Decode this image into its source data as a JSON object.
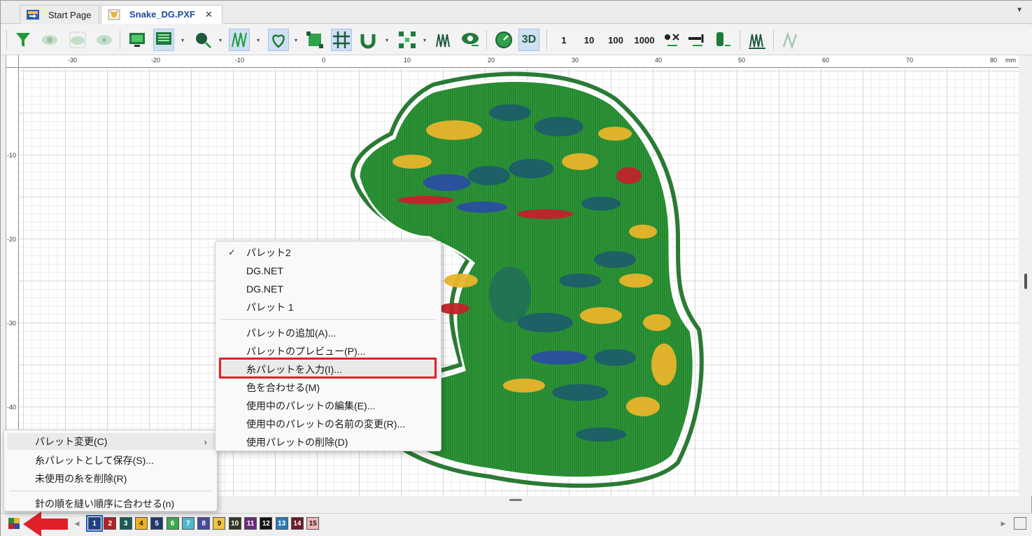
{
  "tabs": {
    "start_page": "Start Page",
    "active_file": "Snake_DG.PXF",
    "close": "✕"
  },
  "toolbar": {
    "count_buttons": [
      "1",
      "10",
      "100",
      "1000"
    ],
    "view_3d": "3D"
  },
  "ruler": {
    "unit": "mm",
    "h_labels": [
      "-30",
      "-20",
      "-10",
      "0",
      "10",
      "20",
      "30",
      "40",
      "50",
      "60",
      "70",
      "80"
    ],
    "v_labels": [
      "-10",
      "-20",
      "-30",
      "-40"
    ]
  },
  "menu_main": {
    "items": [
      {
        "label": "パレット変更(C)",
        "has_submenu": true
      },
      {
        "label": "糸パレットとして保存(S)..."
      },
      {
        "label": "未使用の糸を削除(R)"
      },
      {
        "label": "針の順を縫い順序に合わせる(n)"
      }
    ]
  },
  "menu_palette": {
    "palettes": [
      {
        "label": "パレット2",
        "checked": true
      },
      {
        "label": "DG.NET"
      },
      {
        "label": "DG.NET"
      },
      {
        "label": "パレット 1"
      }
    ],
    "actions": [
      {
        "label": "パレットの追加(A)..."
      },
      {
        "label": "パレットのプレビュー(P)..."
      },
      {
        "label": "糸パレットを入力(I)...",
        "highlighted": true
      },
      {
        "label": "色を合わせる(M)"
      },
      {
        "label": "使用中のパレットの編集(E)..."
      },
      {
        "label": "使用中のパレットの名前の変更(R)..."
      },
      {
        "label": "使用パレットの削除(D)"
      }
    ]
  },
  "needles": [
    {
      "num": "1",
      "color": "#1d3f87",
      "text": "#ffffff"
    },
    {
      "num": "2",
      "color": "#b32025",
      "text": "#ffffff"
    },
    {
      "num": "3",
      "color": "#1a5c55",
      "text": "#ffffff"
    },
    {
      "num": "4",
      "color": "#f0b020",
      "text": "#1a1a1a"
    },
    {
      "num": "5",
      "color": "#1f3a6b",
      "text": "#ffffff"
    },
    {
      "num": "6",
      "color": "#3aa84a",
      "text": "#ffffff"
    },
    {
      "num": "7",
      "color": "#4fb7cc",
      "text": "#ffffff"
    },
    {
      "num": "8",
      "color": "#4a4a9a",
      "text": "#ffffff"
    },
    {
      "num": "9",
      "color": "#f3c53a",
      "text": "#1a1a1a"
    },
    {
      "num": "10",
      "color": "#2e3a24",
      "text": "#ffffff"
    },
    {
      "num": "11",
      "color": "#6a2c7a",
      "text": "#ffffff"
    },
    {
      "num": "12",
      "color": "#111111",
      "text": "#ffffff"
    },
    {
      "num": "13",
      "color": "#2a7bb8",
      "text": "#ffffff"
    },
    {
      "num": "14",
      "color": "#6a1a28",
      "text": "#ffffff"
    },
    {
      "num": "15",
      "color": "#f4b6b6",
      "text": "#1a1a1a"
    }
  ],
  "colors": {
    "accent_green": "#1f9a3b",
    "highlight_box": "#e0202a",
    "active_tab_text": "#1a4b9a"
  }
}
